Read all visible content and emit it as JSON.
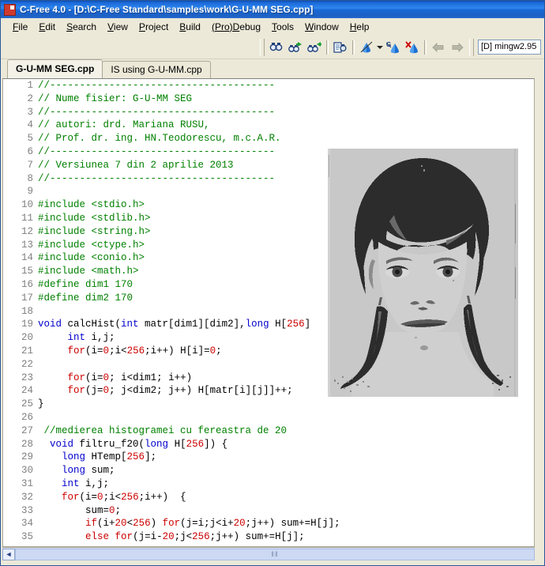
{
  "window": {
    "title": "C-Free 4.0 - [D:\\C-Free Standard\\samples\\work\\G-U-MM SEG.cpp]",
    "app_icon": "c-free-app-icon"
  },
  "menu": {
    "items": [
      {
        "acc": "F",
        "rest": "ile"
      },
      {
        "acc": "E",
        "rest": "dit"
      },
      {
        "acc": "S",
        "rest": "earch"
      },
      {
        "acc": "V",
        "rest": "iew"
      },
      {
        "acc": "P",
        "rest": "roject"
      },
      {
        "acc": "B",
        "rest": "uild"
      },
      {
        "acc": "(Pro)D",
        "rest": "ebug"
      },
      {
        "acc": "T",
        "rest": "ools"
      },
      {
        "acc": "W",
        "rest": "indow"
      },
      {
        "acc": "H",
        "rest": "elp"
      }
    ]
  },
  "toolbar": {
    "buttons": [
      {
        "name": "find-icon",
        "tip": "Find"
      },
      {
        "name": "find-next-icon",
        "tip": "Find Next"
      },
      {
        "name": "find-previous-icon",
        "tip": "Find Previous"
      },
      {
        "name": "replace-icon",
        "tip": "Replace"
      },
      {
        "name": "run-icon",
        "tip": "Run"
      },
      {
        "name": "run-dropdown-icon",
        "tip": "Run options"
      },
      {
        "name": "build-run-icon",
        "tip": "Build and Run"
      },
      {
        "name": "stop-icon",
        "tip": "Stop"
      },
      {
        "name": "navigate-back-icon",
        "tip": "Back"
      },
      {
        "name": "navigate-forward-icon",
        "tip": "Forward"
      }
    ],
    "compiler_selector": "[D] mingw2.95"
  },
  "tabs": [
    {
      "label": "G-U-MM SEG.cpp",
      "active": true
    },
    {
      "label": "IS using G-U-MM.cpp",
      "active": false
    }
  ],
  "editor": {
    "first_line": 1,
    "lines": [
      {
        "n": "1",
        "tokens": [
          {
            "t": "//--------------------------------------",
            "c": "tok-c"
          }
        ]
      },
      {
        "n": "2",
        "tokens": [
          {
            "t": "// Nume fisier: G-U-MM SEG",
            "c": "tok-c"
          }
        ]
      },
      {
        "n": "3",
        "tokens": [
          {
            "t": "//--------------------------------------",
            "c": "tok-c"
          }
        ]
      },
      {
        "n": "4",
        "tokens": [
          {
            "t": "// autori: drd. Mariana RUSU,",
            "c": "tok-c"
          }
        ]
      },
      {
        "n": "5",
        "tokens": [
          {
            "t": "// Prof. dr. ing. HN.Teodorescu, m.c.A.R.",
            "c": "tok-c"
          }
        ]
      },
      {
        "n": "6",
        "tokens": [
          {
            "t": "//--------------------------------------",
            "c": "tok-c"
          }
        ]
      },
      {
        "n": "7",
        "tokens": [
          {
            "t": "// Versiunea 7 din 2 aprilie 2013",
            "c": "tok-c"
          }
        ]
      },
      {
        "n": "8",
        "tokens": [
          {
            "t": "//--------------------------------------",
            "c": "tok-c"
          }
        ]
      },
      {
        "n": "9",
        "tokens": []
      },
      {
        "n": "10",
        "tokens": [
          {
            "t": "#include <stdio.h>",
            "c": "tok-c"
          }
        ]
      },
      {
        "n": "11",
        "tokens": [
          {
            "t": "#include <stdlib.h>",
            "c": "tok-c"
          }
        ]
      },
      {
        "n": "12",
        "tokens": [
          {
            "t": "#include <string.h>",
            "c": "tok-c"
          }
        ]
      },
      {
        "n": "13",
        "tokens": [
          {
            "t": "#include <ctype.h>",
            "c": "tok-c"
          }
        ]
      },
      {
        "n": "14",
        "tokens": [
          {
            "t": "#include <conio.h>",
            "c": "tok-c"
          }
        ]
      },
      {
        "n": "15",
        "tokens": [
          {
            "t": "#include <math.h>",
            "c": "tok-c"
          }
        ]
      },
      {
        "n": "16",
        "tokens": [
          {
            "t": "#define dim1 170",
            "c": "tok-c"
          }
        ]
      },
      {
        "n": "17",
        "tokens": [
          {
            "t": "#define dim2 170",
            "c": "tok-c"
          }
        ]
      },
      {
        "n": "18",
        "tokens": []
      },
      {
        "n": "19",
        "tokens": [
          {
            "t": "void",
            "c": "tok-k"
          },
          {
            "t": " calcHist(",
            "c": "codetext"
          },
          {
            "t": "int",
            "c": "tok-k"
          },
          {
            "t": " matr[dim1][dim2],",
            "c": "codetext"
          },
          {
            "t": "long",
            "c": "tok-k"
          },
          {
            "t": " H[",
            "c": "codetext"
          },
          {
            "t": "256",
            "c": "tok-r"
          },
          {
            "t": "]",
            "c": "codetext"
          }
        ]
      },
      {
        "n": "20",
        "tokens": [
          {
            "t": "     ",
            "c": "codetext"
          },
          {
            "t": "int",
            "c": "tok-k"
          },
          {
            "t": " i,j;",
            "c": "codetext"
          }
        ]
      },
      {
        "n": "21",
        "tokens": [
          {
            "t": "     ",
            "c": "codetext"
          },
          {
            "t": "for",
            "c": "tok-r"
          },
          {
            "t": "(i=",
            "c": "codetext"
          },
          {
            "t": "0",
            "c": "tok-r"
          },
          {
            "t": ";i<",
            "c": "codetext"
          },
          {
            "t": "256",
            "c": "tok-r"
          },
          {
            "t": ";i++) H[i]=",
            "c": "codetext"
          },
          {
            "t": "0",
            "c": "tok-r"
          },
          {
            "t": ";",
            "c": "codetext"
          }
        ]
      },
      {
        "n": "22",
        "tokens": []
      },
      {
        "n": "23",
        "tokens": [
          {
            "t": "     ",
            "c": "codetext"
          },
          {
            "t": "for",
            "c": "tok-r"
          },
          {
            "t": "(i=",
            "c": "codetext"
          },
          {
            "t": "0",
            "c": "tok-r"
          },
          {
            "t": "; i<dim1; i++)",
            "c": "codetext"
          }
        ]
      },
      {
        "n": "24",
        "tokens": [
          {
            "t": "     ",
            "c": "codetext"
          },
          {
            "t": "for",
            "c": "tok-r"
          },
          {
            "t": "(j=",
            "c": "codetext"
          },
          {
            "t": "0",
            "c": "tok-r"
          },
          {
            "t": "; j<dim2; j++) H[matr[i][j]]++;",
            "c": "codetext"
          }
        ]
      },
      {
        "n": "25",
        "tokens": [
          {
            "t": "}",
            "c": "codetext"
          }
        ]
      },
      {
        "n": "26",
        "tokens": []
      },
      {
        "n": "27",
        "tokens": [
          {
            "t": " //medierea histogramei cu fereastra de 20",
            "c": "tok-c"
          }
        ]
      },
      {
        "n": "28",
        "tokens": [
          {
            "t": "  ",
            "c": "codetext"
          },
          {
            "t": "void",
            "c": "tok-k"
          },
          {
            "t": " filtru_f20(",
            "c": "codetext"
          },
          {
            "t": "long",
            "c": "tok-k"
          },
          {
            "t": " H[",
            "c": "codetext"
          },
          {
            "t": "256",
            "c": "tok-r"
          },
          {
            "t": "]) {",
            "c": "codetext"
          }
        ]
      },
      {
        "n": "29",
        "tokens": [
          {
            "t": "    ",
            "c": "codetext"
          },
          {
            "t": "long",
            "c": "tok-k"
          },
          {
            "t": " HTemp[",
            "c": "codetext"
          },
          {
            "t": "256",
            "c": "tok-r"
          },
          {
            "t": "];",
            "c": "codetext"
          }
        ]
      },
      {
        "n": "30",
        "tokens": [
          {
            "t": "    ",
            "c": "codetext"
          },
          {
            "t": "long",
            "c": "tok-k"
          },
          {
            "t": " sum;",
            "c": "codetext"
          }
        ]
      },
      {
        "n": "31",
        "tokens": [
          {
            "t": "    ",
            "c": "codetext"
          },
          {
            "t": "int",
            "c": "tok-k"
          },
          {
            "t": " i,j;",
            "c": "codetext"
          }
        ]
      },
      {
        "n": "32",
        "tokens": [
          {
            "t": "    ",
            "c": "codetext"
          },
          {
            "t": "for",
            "c": "tok-r"
          },
          {
            "t": "(i=",
            "c": "codetext"
          },
          {
            "t": "0",
            "c": "tok-r"
          },
          {
            "t": ";i<",
            "c": "codetext"
          },
          {
            "t": "256",
            "c": "tok-r"
          },
          {
            "t": ";i++)  {",
            "c": "codetext"
          }
        ]
      },
      {
        "n": "33",
        "tokens": [
          {
            "t": "        sum=",
            "c": "codetext"
          },
          {
            "t": "0",
            "c": "tok-r"
          },
          {
            "t": ";",
            "c": "codetext"
          }
        ]
      },
      {
        "n": "34",
        "tokens": [
          {
            "t": "        ",
            "c": "codetext"
          },
          {
            "t": "if",
            "c": "tok-r"
          },
          {
            "t": "(i+",
            "c": "codetext"
          },
          {
            "t": "20",
            "c": "tok-r"
          },
          {
            "t": "<",
            "c": "codetext"
          },
          {
            "t": "256",
            "c": "tok-r"
          },
          {
            "t": ") ",
            "c": "codetext"
          },
          {
            "t": "for",
            "c": "tok-r"
          },
          {
            "t": "(j=i;j<i+",
            "c": "codetext"
          },
          {
            "t": "20",
            "c": "tok-r"
          },
          {
            "t": ";j++) sum+=H[j];",
            "c": "codetext"
          }
        ]
      },
      {
        "n": "35",
        "tokens": [
          {
            "t": "        ",
            "c": "codetext"
          },
          {
            "t": "else",
            "c": "tok-r"
          },
          {
            "t": " ",
            "c": "codetext"
          },
          {
            "t": "for",
            "c": "tok-r"
          },
          {
            "t": "(j=i-",
            "c": "codetext"
          },
          {
            "t": "20",
            "c": "tok-r"
          },
          {
            "t": ";j<",
            "c": "codetext"
          },
          {
            "t": "256",
            "c": "tok-r"
          },
          {
            "t": ";j++) sum+=H[j];",
            "c": "codetext"
          }
        ]
      }
    ]
  },
  "image_overlay": {
    "name": "segmented-portrait-image",
    "description": "Posterized grayscale segmented portrait of a woman with bob haircut",
    "background_gray": "#c8c8c8",
    "dark_gray": "#2b2b2b",
    "mid_gray": "#6e6e6e",
    "light_gray": "#d4d4d4"
  },
  "scrollbar": {
    "left_arrow": "◄",
    "grip": "‖‖"
  },
  "colors": {
    "comment": "#008000",
    "keyword": "#0000cd",
    "control": "#cc0000",
    "linenumber": "#808080",
    "titlebar": "#1b68d8",
    "chrome": "#ece9d8"
  }
}
